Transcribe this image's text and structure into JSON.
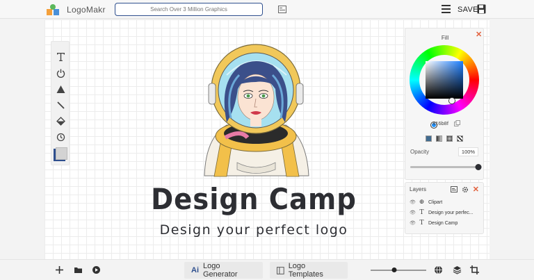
{
  "app": {
    "brand": "LogoMakr",
    "search_placeholder": "Search Over 3 Million Graphics",
    "save_label": "SAVE"
  },
  "tools": [
    {
      "name": "text-tool",
      "icon": "text-icon"
    },
    {
      "name": "power-tool",
      "icon": "power-icon"
    },
    {
      "name": "shape-tool",
      "icon": "triangle-icon"
    },
    {
      "name": "line-tool",
      "icon": "line-icon"
    },
    {
      "name": "fill-tool",
      "icon": "paint-bucket-icon"
    },
    {
      "name": "history-tool",
      "icon": "history-icon"
    }
  ],
  "canvas": {
    "title": "Design Camp",
    "tagline": "Design your perfect logo"
  },
  "fill_panel": {
    "title": "Fill",
    "hex": "416b8f",
    "opacity_label": "Opacity",
    "opacity_value": "100%",
    "opacity_level": 1.0,
    "selected_color": "#416b8f"
  },
  "layers_panel": {
    "title": "Layers",
    "layers": [
      {
        "type": "clipart",
        "label": "Clipart"
      },
      {
        "type": "text",
        "label": "Design your perfec..."
      },
      {
        "type": "text",
        "label": "Design Camp"
      }
    ]
  },
  "bottom": {
    "logo_generator": "Logo Generator",
    "ai_badge": "Ai",
    "logo_templates": "Logo Templates",
    "zoom_level": 0.42
  },
  "colors": {
    "accent": "#2e4f8e",
    "close": "#e2603c",
    "title_text": "#2d2e33"
  }
}
